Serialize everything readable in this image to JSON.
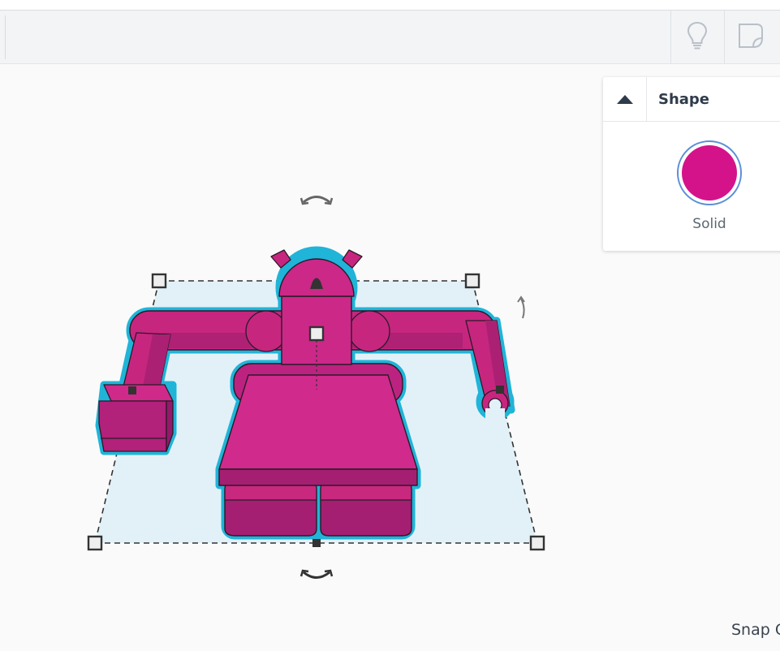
{
  "toolbar": {
    "buttons": [
      {
        "name": "hint-lightbulb-icon"
      },
      {
        "name": "notes-icon"
      }
    ]
  },
  "inspector": {
    "title": "Shape",
    "collapse_icon": "chevron-up-icon",
    "mode_label": "Solid",
    "shape_color": "#d4138a"
  },
  "workplane": {
    "snap_label": "Snap G"
  },
  "colors": {
    "shape": "#cc2a8c",
    "shape_dark": "#a31f70",
    "outline": "#20b4d8",
    "selection_fill": "#dff0f8"
  }
}
